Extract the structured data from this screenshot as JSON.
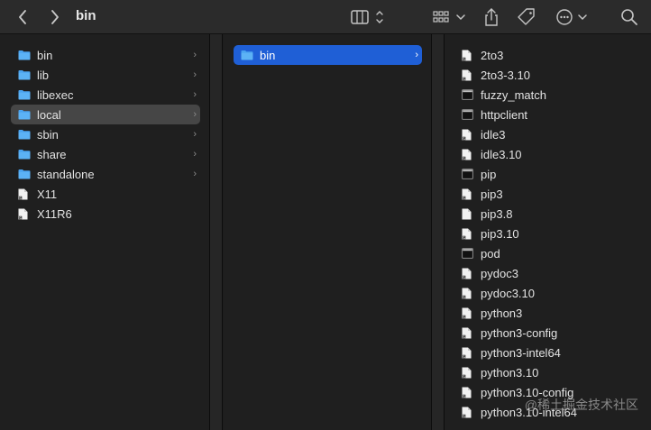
{
  "window": {
    "title": "bin"
  },
  "toolbar": {
    "back_icon": "chevron-left-icon",
    "forward_icon": "chevron-right-icon",
    "view_icon": "column-view-icon",
    "group_icon": "grid-group-icon",
    "share_icon": "share-icon",
    "tag_icon": "tag-icon",
    "more_icon": "ellipsis-circle-icon",
    "search_icon": "search-icon"
  },
  "column1": {
    "items": [
      {
        "label": "bin",
        "kind": "folder",
        "has_children": true
      },
      {
        "label": "lib",
        "kind": "folder",
        "has_children": true
      },
      {
        "label": "libexec",
        "kind": "folder",
        "has_children": true
      },
      {
        "label": "local",
        "kind": "folder",
        "has_children": true,
        "selected": "inactive"
      },
      {
        "label": "sbin",
        "kind": "folder",
        "has_children": true
      },
      {
        "label": "share",
        "kind": "folder",
        "has_children": true
      },
      {
        "label": "standalone",
        "kind": "folder",
        "has_children": true
      },
      {
        "label": "X11",
        "kind": "alias"
      },
      {
        "label": "X11R6",
        "kind": "alias"
      }
    ]
  },
  "column2": {
    "items": [
      {
        "label": "bin",
        "kind": "folder",
        "has_children": true,
        "selected": "active"
      }
    ]
  },
  "column3": {
    "items": [
      {
        "label": "2to3",
        "kind": "alias"
      },
      {
        "label": "2to3-3.10",
        "kind": "alias"
      },
      {
        "label": "fuzzy_match",
        "kind": "exec"
      },
      {
        "label": "httpclient",
        "kind": "exec"
      },
      {
        "label": "idle3",
        "kind": "alias"
      },
      {
        "label": "idle3.10",
        "kind": "alias"
      },
      {
        "label": "pip",
        "kind": "exec"
      },
      {
        "label": "pip3",
        "kind": "alias"
      },
      {
        "label": "pip3.8",
        "kind": "doc"
      },
      {
        "label": "pip3.10",
        "kind": "alias"
      },
      {
        "label": "pod",
        "kind": "exec"
      },
      {
        "label": "pydoc3",
        "kind": "alias"
      },
      {
        "label": "pydoc3.10",
        "kind": "alias"
      },
      {
        "label": "python3",
        "kind": "alias"
      },
      {
        "label": "python3-config",
        "kind": "alias"
      },
      {
        "label": "python3-intel64",
        "kind": "alias"
      },
      {
        "label": "python3.10",
        "kind": "alias"
      },
      {
        "label": "python3.10-config",
        "kind": "alias"
      },
      {
        "label": "python3.10-intel64",
        "kind": "alias"
      }
    ]
  },
  "watermark": "@稀土掘金技术社区",
  "colors": {
    "folder": "#4aa3f0",
    "selected_active": "#1f5fd6",
    "selected_inactive": "#464646"
  }
}
